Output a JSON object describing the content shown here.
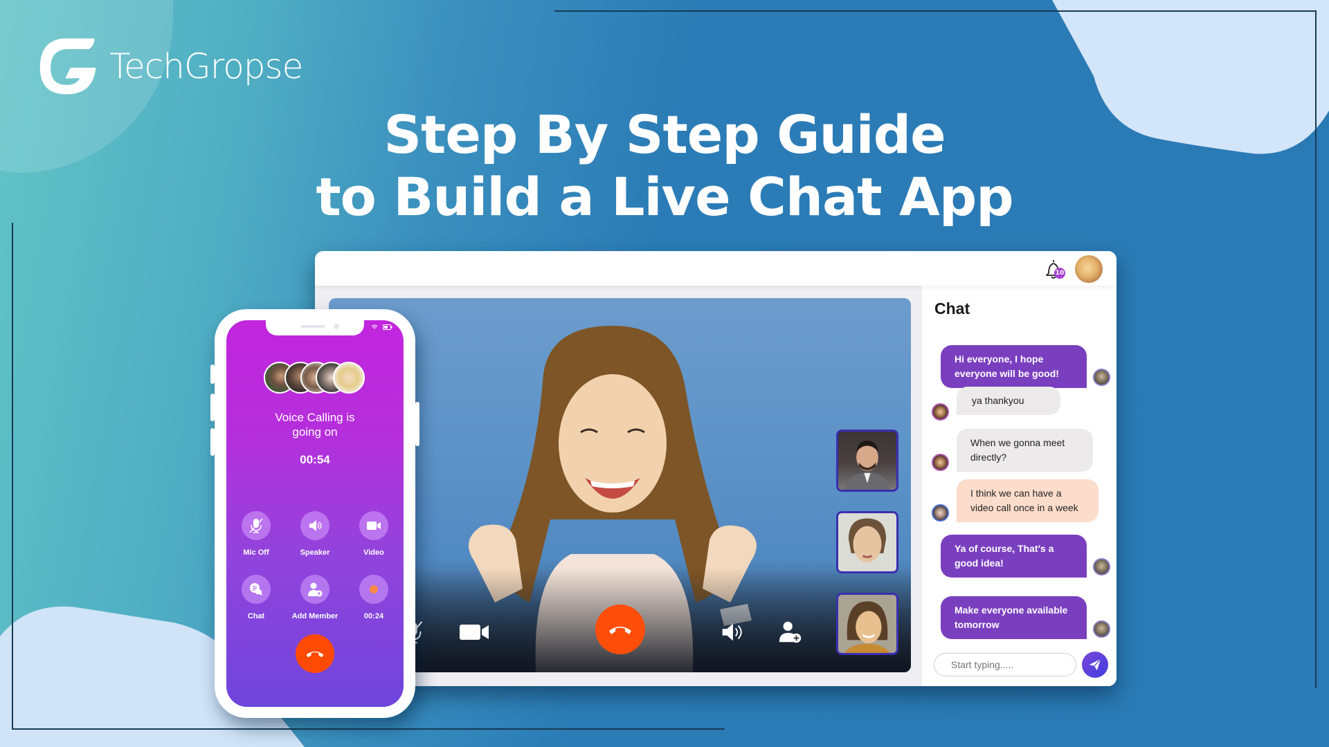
{
  "brand": {
    "name": "TechGropse",
    "logo_icon": "g-logo-icon"
  },
  "headline": {
    "line1": "Step By Step Guide",
    "line2": "to Build a Live Chat App"
  },
  "desktop_app": {
    "topbar": {
      "notification_icon": "bell-icon",
      "notification_count": "10",
      "user_avatar": "user-avatar"
    },
    "video_call": {
      "controls": [
        {
          "name": "mic-off",
          "icon": "mic-off-icon"
        },
        {
          "name": "video",
          "icon": "video-camera-icon"
        },
        {
          "name": "end-call",
          "icon": "phone-hangup-icon",
          "color": "#ff4e0a"
        },
        {
          "name": "speaker",
          "icon": "speaker-icon"
        },
        {
          "name": "add-member",
          "icon": "add-user-icon"
        }
      ],
      "participant_thumbnails": [
        "participant-1",
        "participant-2",
        "participant-3"
      ]
    },
    "chat": {
      "title": "Chat",
      "messages": [
        {
          "side": "out",
          "text": "Hi everyone, I hope everyone will be good!"
        },
        {
          "side": "in",
          "text": "ya thankyou"
        },
        {
          "side": "in",
          "text": "When we gonna meet directly?"
        },
        {
          "side": "in",
          "text": "I think we can have a video call once in a week"
        },
        {
          "side": "out",
          "text": "Ya of course, That's a good idea!"
        },
        {
          "side": "out",
          "text": "Make everyone available tomorrow"
        }
      ],
      "input": {
        "value": "",
        "placeholder": "Start typing....."
      },
      "send_icon": "send-icon",
      "colors": {
        "outgoing": "#7a3fbf",
        "incoming": "#eceaea",
        "highlight": "#fcdccb"
      }
    }
  },
  "phone_app": {
    "status": "Voice Calling is going on",
    "timer": "00:54",
    "buttons": [
      {
        "label": "Mic Off",
        "icon": "mic-off-icon"
      },
      {
        "label": "Speaker",
        "icon": "speaker-icon"
      },
      {
        "label": "Video",
        "icon": "video-camera-icon"
      },
      {
        "label": "Chat",
        "icon": "chat-bubbles-icon"
      },
      {
        "label": "Add Member",
        "icon": "add-user-icon"
      },
      {
        "label": "00:24",
        "icon": "record-dot-icon"
      }
    ],
    "end_call_icon": "phone-hangup-icon",
    "participant_count": 5
  }
}
